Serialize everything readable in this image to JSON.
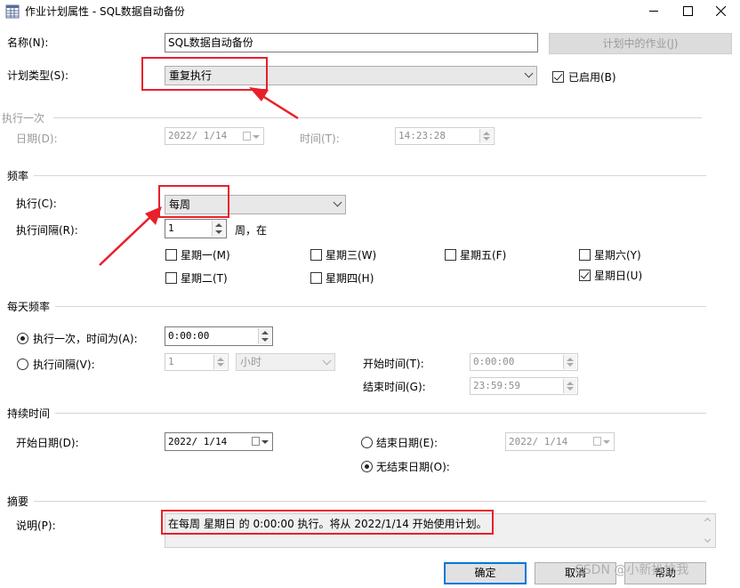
{
  "window": {
    "title": "作业计划属性 - SQL数据自动备份"
  },
  "name": {
    "label": "名称(N):",
    "value": "SQL数据自动备份",
    "jobs_button": "计划中的作业(J)"
  },
  "schedule_type": {
    "label": "计划类型(S):",
    "value": "重复执行",
    "enabled_label": "已启用(B)",
    "enabled": true
  },
  "one_time": {
    "header": "执行一次",
    "date_label": "日期(D):",
    "date_value": "2022/ 1/14",
    "time_label": "时间(T):",
    "time_value": "14:23:28"
  },
  "frequency": {
    "header": "频率",
    "occurs_label": "执行(C):",
    "occurs_value": "每周",
    "recur_label": "执行间隔(R):",
    "recur_value": "1",
    "recur_unit": "周，在",
    "days": [
      {
        "label": "星期一(M)",
        "checked": false
      },
      {
        "label": "星期三(W)",
        "checked": false
      },
      {
        "label": "星期五(F)",
        "checked": false
      },
      {
        "label": "星期六(Y)",
        "checked": false
      },
      {
        "label": "星期二(T)",
        "checked": false
      },
      {
        "label": "星期四(H)",
        "checked": false
      },
      {
        "label": "星期日(U)",
        "checked": true
      }
    ]
  },
  "daily": {
    "header": "每天频率",
    "once_label": "执行一次，时间为(A):",
    "once_value": "0:00:00",
    "every_label": "执行间隔(V):",
    "every_value": "1",
    "every_unit": "小时",
    "start_label": "开始时间(T):",
    "start_value": "0:00:00",
    "end_label": "结束时间(G):",
    "end_value": "23:59:59"
  },
  "duration": {
    "header": "持续时间",
    "start_label": "开始日期(D):",
    "start_value": "2022/ 1/14",
    "end_label": "结束日期(E):",
    "end_value": "2022/ 1/14",
    "noend_label": "无结束日期(O):"
  },
  "summary": {
    "header": "摘要",
    "desc_label": "说明(P):",
    "desc_value": "在每周 星期日 的 0:00:00 执行。将从 2022/1/14 开始使用计划。"
  },
  "buttons": {
    "ok": "确定",
    "cancel": "取消",
    "help": "帮助"
  },
  "watermark": "CSDN @小新扒拉我",
  "colors": {
    "annotation": "#e8202a",
    "accent": "#0078d7"
  }
}
